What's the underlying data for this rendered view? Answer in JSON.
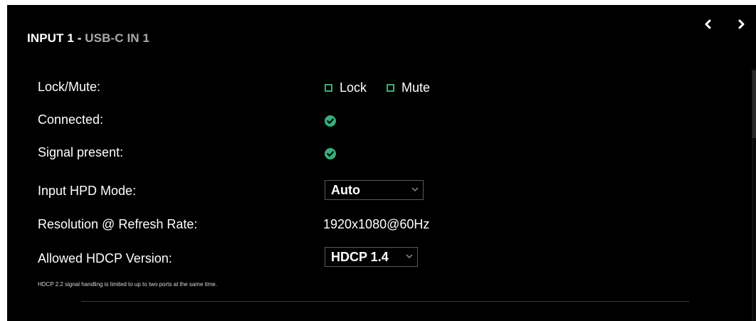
{
  "header": {
    "title": "INPUT 1 - ",
    "subtitle": "USB-C IN 1",
    "prev_icon": "chevron-left-icon",
    "next_icon": "chevron-right-icon"
  },
  "rows": {
    "lock_mute": {
      "label": "Lock/Mute:",
      "lock_label": "Lock",
      "lock_checked": false,
      "mute_label": "Mute",
      "mute_checked": false
    },
    "connected": {
      "label": "Connected:",
      "status_icon": "check-circle-icon"
    },
    "signal_present": {
      "label": "Signal present:",
      "status_icon": "check-circle-icon"
    },
    "hpd_mode": {
      "label": "Input HPD Mode:",
      "selected": "Auto"
    },
    "resolution": {
      "label": "Resolution @ Refresh Rate:",
      "value": "1920x1080@60Hz"
    },
    "hdcp": {
      "label": "Allowed HDCP Version:",
      "selected": "HDCP 1.4"
    }
  },
  "note": "HDCP 2.2 signal handling is limited to up to two ports at the same time.",
  "colors": {
    "accent": "#34b07a",
    "background": "#000000",
    "subtitle": "#a9a9a9"
  }
}
